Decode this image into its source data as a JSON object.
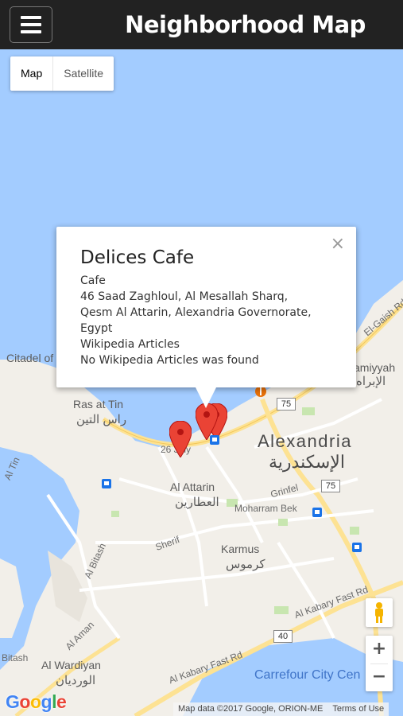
{
  "header": {
    "title": "Neighborhood Map",
    "menu_icon": "hamburger-menu-icon"
  },
  "map_type": {
    "map_label": "Map",
    "satellite_label": "Satellite",
    "selected": "Map"
  },
  "info_window": {
    "title": "Delices Cafe",
    "category": "Cafe",
    "address_line_1": "46 Saad Zaghloul, Al Mesallah Sharq,",
    "address_line_2": "Qesm Al Attarin, Alexandria Governorate,",
    "address_line_3": "Egypt",
    "wiki_heading": "Wikipedia Articles",
    "wiki_result": "No Wikipedia Articles was found",
    "close_icon": "close-icon"
  },
  "map_labels": {
    "citadel": "Citadel of",
    "ras_at_tin_en": "Ras at Tin",
    "ras_at_tin_ar": "راس التين",
    "alexandria_en": "Alexandria",
    "alexandria_ar": "الإسكندرية",
    "al_attarin_en": "Al Attarin",
    "al_attarin_ar": "العطارين",
    "karmus_en": "Karmus",
    "karmus_ar": "كرموس",
    "al_wardiyan_en": "Al Wardiyan",
    "al_wardiyan_ar": "الورديان",
    "el_gaish": "El-Gaish Rd",
    "miyyah_en": "amiyyah",
    "miyyah_ar": "الإبراه",
    "twentysix_july": "26 July",
    "grinfel": "Grinfel",
    "moharram_bek": "Moharram Bek",
    "sherif": "Sherif",
    "al_kabary_1": "Al Kabary Fast Rd",
    "al_kabary_2": "Al Kabary Fast Rd",
    "al_amir": "Al Aman",
    "al_bitash": "Al Bitash",
    "al_tin": "Al Tin",
    "carrefour": "Carrefour City Cen",
    "bitash": "Bitash"
  },
  "route_shields": [
    "75",
    "75",
    "40"
  ],
  "markers": [
    {
      "name": "marker-1",
      "color": "#ea4335"
    },
    {
      "name": "marker-2",
      "color": "#ea4335"
    },
    {
      "name": "marker-3",
      "color": "#ea4335"
    }
  ],
  "controls": {
    "zoom_in": "+",
    "zoom_out": "−",
    "pegman_icon": "pegman-icon"
  },
  "footer": {
    "logo": "Google",
    "map_data": "Map data ©2017 Google, ORION-ME",
    "terms": "Terms of Use"
  },
  "colors": {
    "header_bg": "#222222",
    "water": "#a3ccff",
    "land": "#f2efe9",
    "highway": "#fde293",
    "marker": "#ea4335"
  }
}
